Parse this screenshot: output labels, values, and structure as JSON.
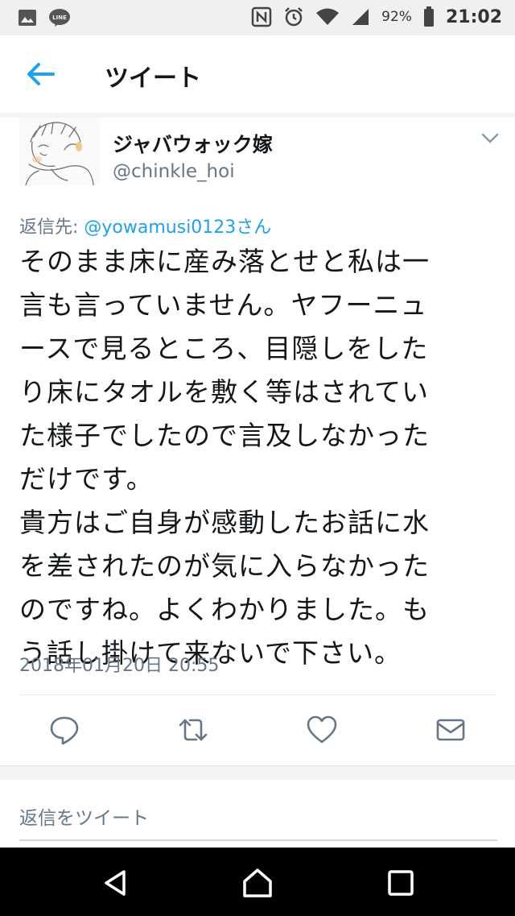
{
  "status_bar": {
    "battery": "92%",
    "time": "21:02"
  },
  "header": {
    "title": "ツイート"
  },
  "tweet": {
    "display_name": "ジャバウォック嫁",
    "handle": "@chinkle_hoi",
    "reply_label": "返信先: ",
    "reply_mention": "@yowamusi0123さん",
    "text_lines": [
      "そのまま床に産み落とせと私は一",
      "言も言っていません。ヤフーニュ",
      "ースで見るところ、目隠しをした",
      "り床にタオルを敷く等はされてい",
      "た様子でしたので言及しなかった",
      "だけです。",
      "貴方はご自身が感動したお話に水",
      "を差されたのが気に入らなかった",
      "のですね。よくわかりました。も",
      "う話し掛けて来ないで下さい。"
    ],
    "timestamp": "2018年01月20日 20:55"
  },
  "actions": {
    "icons": [
      "reply-icon",
      "retweet-icon",
      "like-icon",
      "direct-message-icon"
    ]
  },
  "reply_box": {
    "placeholder": "返信をツイート"
  },
  "colors": {
    "accent": "#1da1f2",
    "text": "#14171a",
    "secondary": "#657786"
  }
}
